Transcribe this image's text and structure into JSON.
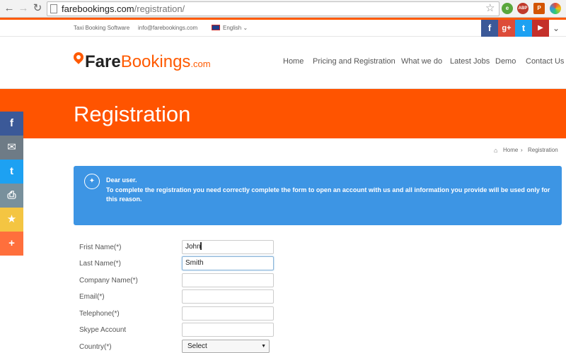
{
  "browser": {
    "url_domain": "farebookings.com",
    "url_path": "/registration/",
    "back": "←",
    "forward": "→",
    "reload": "↻",
    "star": "☆",
    "extensions": [
      {
        "name": "evernote-icon",
        "color": "#5aa73c",
        "label": "e"
      },
      {
        "name": "adblock-icon",
        "color": "#c0392b",
        "label": "ABP"
      },
      {
        "name": "pocket-icon",
        "color": "#d35400",
        "label": "P"
      },
      {
        "name": "colorful-icon",
        "color": "#8e44ad",
        "label": "●"
      }
    ]
  },
  "topbar": {
    "tagline": "Taxi Booking Software",
    "email": "info@farebookings.com",
    "language": "English ⌄",
    "social": [
      "f",
      "g+",
      "t",
      "▶"
    ],
    "chevron": "⌄"
  },
  "logo": {
    "fare": "Fare",
    "bookings": "Bookings",
    "com": ".com"
  },
  "nav": [
    "Home",
    "Pricing and Registration",
    "What we do",
    "Latest Jobs",
    "Demo",
    "Contact Us"
  ],
  "banner": {
    "title": "Registration"
  },
  "breadcrumb": {
    "home": "Home",
    "sep": "›",
    "current": "Registration",
    "home_icon": "⌂"
  },
  "info": {
    "icon": "💡",
    "title": "Dear user.",
    "message": "To complete the registration you need correctly complete the form to open an account with us and all information you provide will be used only for this reason."
  },
  "form": {
    "fields": [
      {
        "label": "Frist Name(*)",
        "value": "John"
      },
      {
        "label": "Last Name(*)",
        "value": "Smith"
      },
      {
        "label": "Company Name(*)",
        "value": ""
      },
      {
        "label": "Email(*)",
        "value": ""
      },
      {
        "label": "Telephone(*)",
        "value": ""
      },
      {
        "label": "Skype Account",
        "value": ""
      }
    ],
    "country": {
      "label": "Country(*)",
      "selected": "Select",
      "arrow": "▼"
    }
  },
  "share": [
    "f",
    "✉",
    "t",
    "⎙",
    "★",
    "+"
  ],
  "colors": {
    "accent": "#ff5a00",
    "info_bg": "#3d95e4",
    "share": [
      "#3b5998",
      "#6e7b86",
      "#1da1f2",
      "#78909c",
      "#f4c542",
      "#ff6f3c"
    ],
    "social": [
      "#3b5998",
      "#dd4b39",
      "#1da1f2",
      "#c4302b"
    ]
  }
}
